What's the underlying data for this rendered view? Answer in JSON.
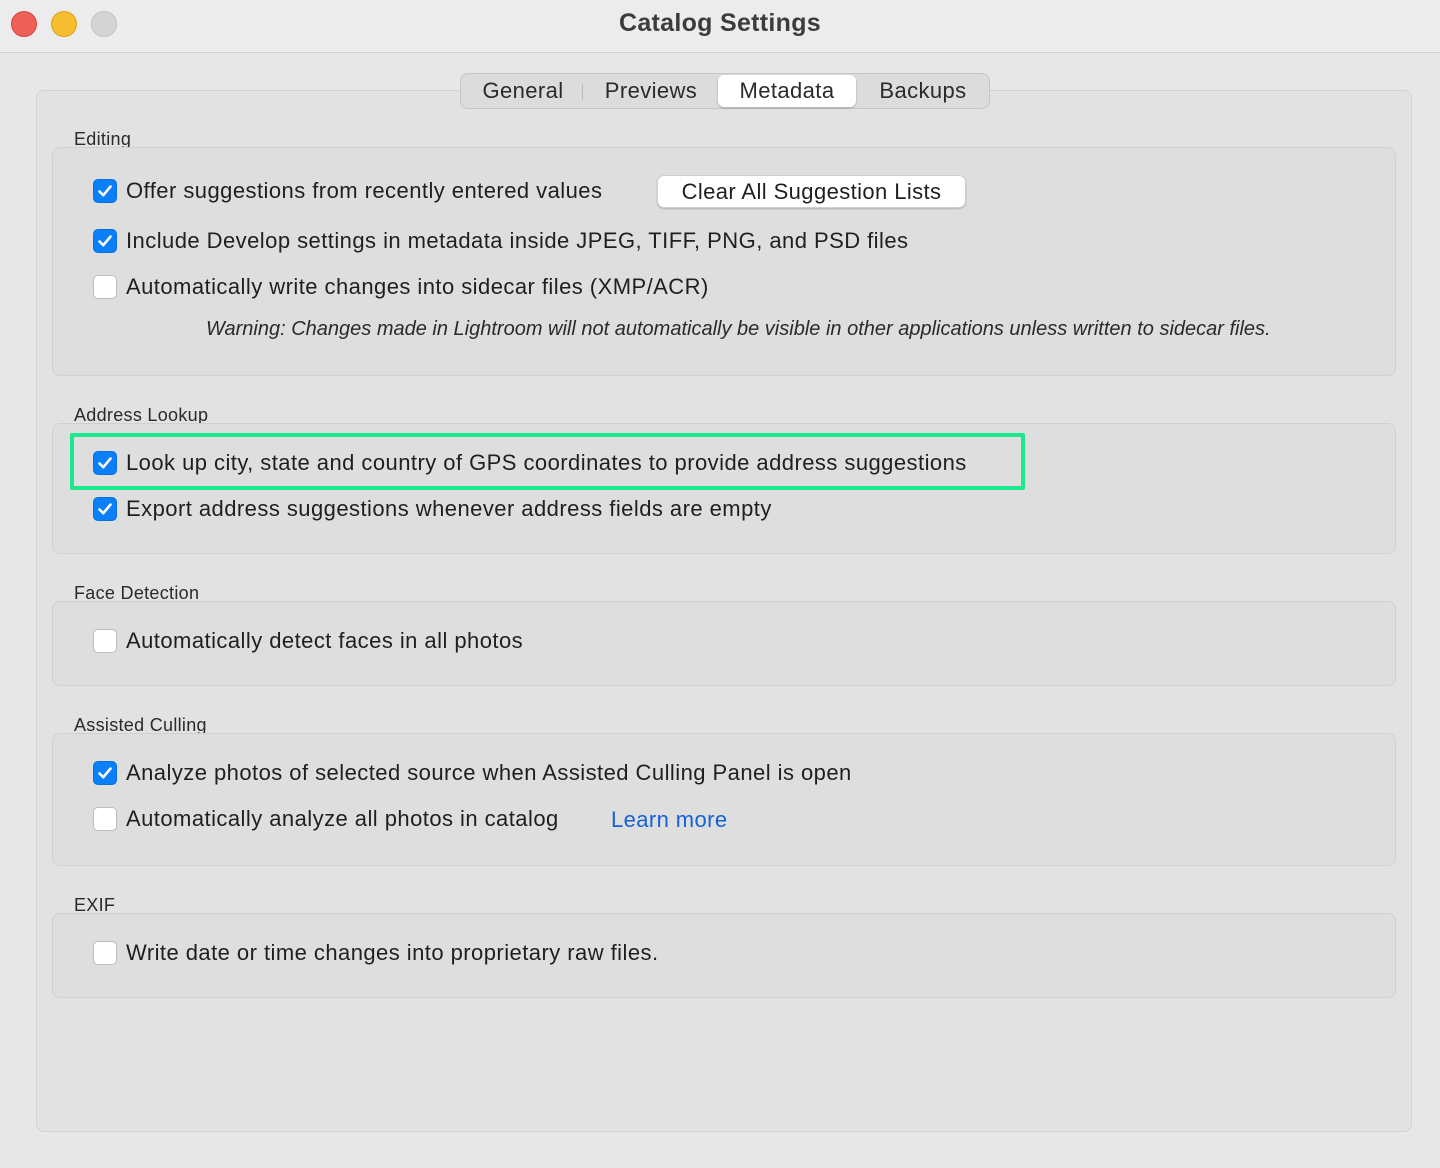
{
  "window": {
    "title": "Catalog Settings"
  },
  "tabs": [
    {
      "label": "General",
      "selected": false
    },
    {
      "label": "Previews",
      "selected": false
    },
    {
      "label": "Metadata",
      "selected": true
    },
    {
      "label": "Backups",
      "selected": false
    }
  ],
  "sections": {
    "editing": {
      "label": "Editing",
      "offer_suggestions": {
        "label": "Offer suggestions from recently entered values",
        "checked": true
      },
      "clear_button_label": "Clear All Suggestion Lists",
      "include_develop": {
        "label": "Include Develop settings in metadata inside JPEG, TIFF, PNG, and PSD files",
        "checked": true
      },
      "auto_write": {
        "label": "Automatically write changes into sidecar files (XMP/ACR)",
        "checked": false
      },
      "warning": "Warning: Changes made in Lightroom will not automatically be visible in other applications unless written to sidecar files."
    },
    "address_lookup": {
      "label": "Address Lookup",
      "lookup_gps": {
        "label": "Look up city, state and country of GPS coordinates to provide address suggestions",
        "checked": true
      },
      "export_suggestions": {
        "label": "Export address suggestions whenever address fields are empty",
        "checked": true
      }
    },
    "face_detection": {
      "label": "Face Detection",
      "detect_faces": {
        "label": "Automatically detect faces in all photos",
        "checked": false
      }
    },
    "assisted_culling": {
      "label": "Assisted Culling",
      "analyze_selected": {
        "label": "Analyze photos of selected source when Assisted Culling Panel is open",
        "checked": true
      },
      "analyze_all": {
        "label": "Automatically analyze all photos in catalog",
        "checked": false
      },
      "learn_more": "Learn more"
    },
    "exif": {
      "label": "EXIF",
      "write_date": {
        "label": "Write date or time changes into proprietary raw files.",
        "checked": false
      }
    }
  },
  "colors": {
    "checkbox_on": "#0a7ff7",
    "highlight": "#1ee88f",
    "link": "#1561d9"
  }
}
